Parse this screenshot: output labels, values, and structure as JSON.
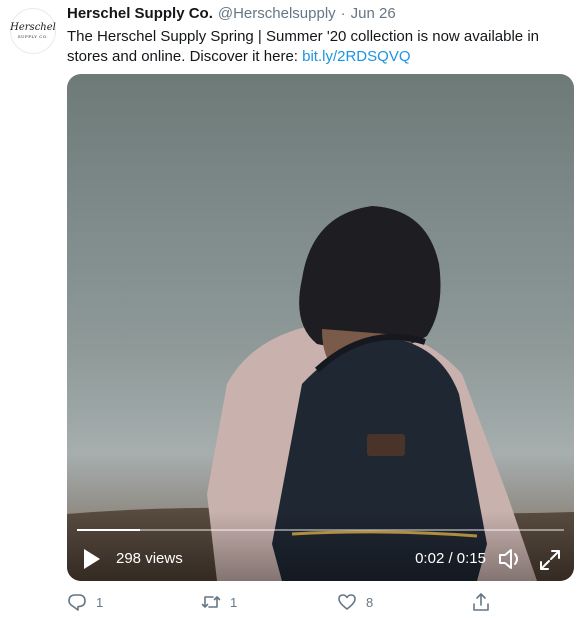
{
  "tweet": {
    "author_name": "Herschel Supply Co.",
    "handle": "@Herschelsupply",
    "separator": "·",
    "date": "Jun 26",
    "text_before_link": "The Herschel Supply Spring | Summer '20 collection is now available in stores and online. Discover it here: ",
    "link_text": "bit.ly/2RDSQVQ",
    "avatar": {
      "logo_text": "Herschel",
      "logo_small_text": "SUPPLY CO."
    }
  },
  "video": {
    "views": "298 views",
    "time": "0:02 / 0:15",
    "progress": 0.13,
    "play_icon": "play-icon",
    "volume_icon": "volume-muted-icon",
    "fullscreen_icon": "fullscreen-icon"
  },
  "actions": {
    "reply_count": "1",
    "retweet_count": "1",
    "like_count": "8"
  },
  "colors": {
    "link": "#1b95e0",
    "muted_text": "#657786",
    "body_text": "#14171a"
  }
}
